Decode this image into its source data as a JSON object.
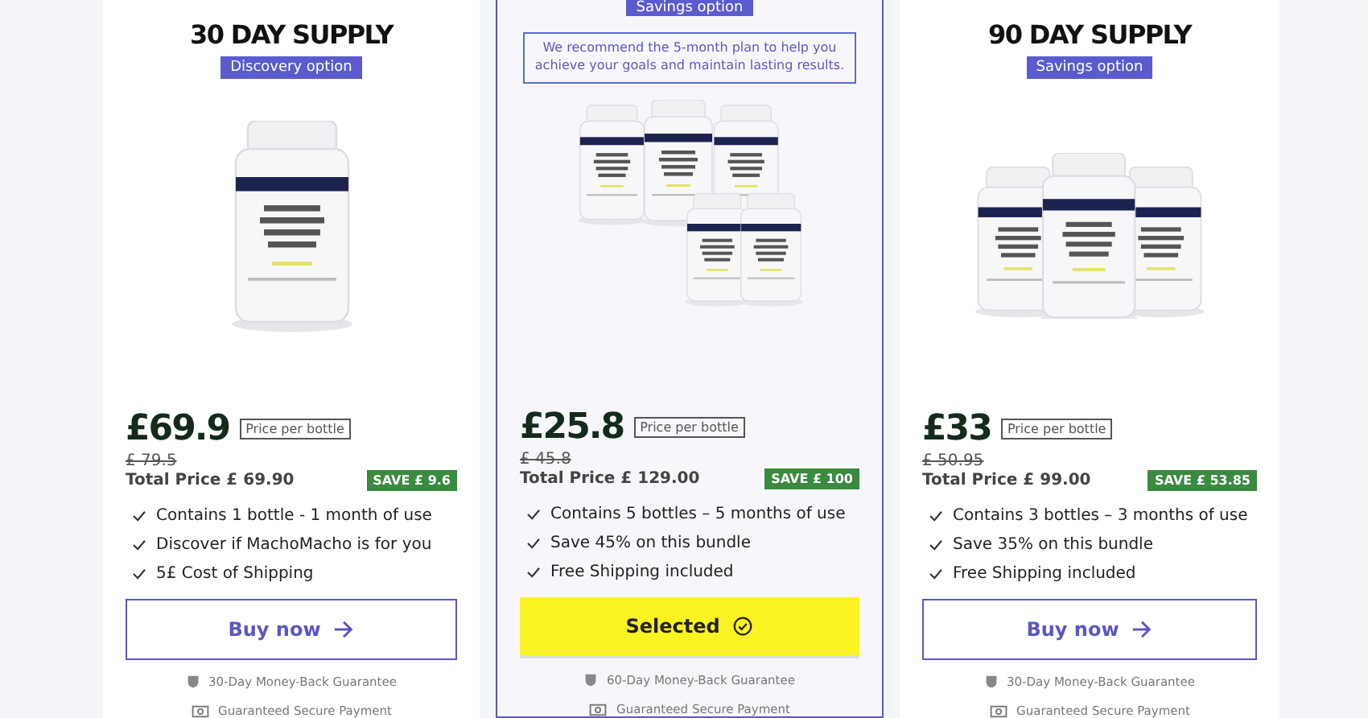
{
  "plans": [
    {
      "title": "30 DAY SUPPLY",
      "badge": "Discovery option",
      "image": {
        "kind": "single"
      },
      "price": "£69.9",
      "unit": "Price per bottle",
      "old_price": "£ 79.5",
      "total": "Total Price £ 69.90",
      "save": "SAVE £ 9.6",
      "features": [
        "Contains 1 bottle - 1 month of use",
        "Discover if MachoMacho is for you",
        "5£ Cost of Shipping"
      ],
      "button": {
        "label": "Buy now",
        "kind": "buy"
      },
      "selected": false,
      "guarantee": "30-Day Money-Back Guarantee",
      "payment": "Guaranteed Secure Payment"
    },
    {
      "badge": "Savings option",
      "note": "We recommend the 5-month plan to help you achieve your goals and maintain lasting results.",
      "image": {
        "kind": "five"
      },
      "price": "£25.8",
      "unit": "Price per bottle",
      "old_price": "£ 45.8",
      "total": "Total Price £ 129.00",
      "save": "SAVE £ 100",
      "features": [
        "Contains 5 bottles – 5 months of use",
        "Save 45% on this bundle",
        "Free Shipping included"
      ],
      "button": {
        "label": "Selected",
        "kind": "selected"
      },
      "selected": true,
      "guarantee": "60-Day Money-Back Guarantee",
      "payment": "Guaranteed Secure Payment"
    },
    {
      "title": "90 DAY SUPPLY",
      "badge": "Savings option",
      "image": {
        "kind": "trio"
      },
      "price": "£33",
      "unit": "Price per bottle",
      "old_price": "£ 50.95",
      "total": "Total Price £ 99.00",
      "save": "SAVE £ 53.85",
      "features": [
        "Contains 3 bottles – 3 months of use",
        "Save 35% on this bundle",
        "Free Shipping included"
      ],
      "button": {
        "label": "Buy now",
        "kind": "buy"
      },
      "selected": false,
      "guarantee": "30-Day Money-Back Guarantee",
      "payment": "Guaranteed Secure Payment"
    }
  ]
}
